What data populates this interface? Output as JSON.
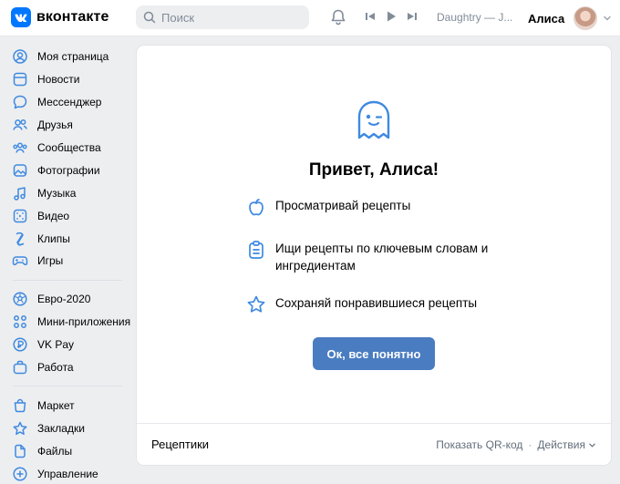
{
  "header": {
    "logo_text": "вконтакте",
    "search_placeholder": "Поиск",
    "now_playing": "Daughtry — J...",
    "user_name": "Алиса"
  },
  "sidebar": {
    "group1": [
      {
        "label": "Моя страница",
        "icon": "user-circle-icon"
      },
      {
        "label": "Новости",
        "icon": "news-icon"
      },
      {
        "label": "Мессенджер",
        "icon": "message-icon"
      },
      {
        "label": "Друзья",
        "icon": "friends-icon"
      },
      {
        "label": "Сообщества",
        "icon": "communities-icon"
      },
      {
        "label": "Фотографии",
        "icon": "photo-icon"
      },
      {
        "label": "Музыка",
        "icon": "music-icon"
      },
      {
        "label": "Видео",
        "icon": "video-icon"
      },
      {
        "label": "Клипы",
        "icon": "clips-icon"
      },
      {
        "label": "Игры",
        "icon": "gamepad-icon"
      }
    ],
    "group2": [
      {
        "label": "Евро-2020",
        "icon": "ball-icon"
      },
      {
        "label": "Мини-приложения",
        "icon": "apps-icon"
      },
      {
        "label": "VK Pay",
        "icon": "vkpay-icon"
      },
      {
        "label": "Работа",
        "icon": "briefcase-icon"
      }
    ],
    "group3": [
      {
        "label": "Маркет",
        "icon": "market-icon"
      },
      {
        "label": "Закладки",
        "icon": "star-icon"
      },
      {
        "label": "Файлы",
        "icon": "file-icon"
      },
      {
        "label": "Управление",
        "icon": "manage-icon"
      }
    ]
  },
  "main": {
    "greeting": "Привет, Алиса!",
    "features": [
      "Просматривай рецепты",
      "Ищи рецепты по ключевым словам и ингредиентам",
      "Сохраняй понравившиеся рецепты"
    ],
    "ok_button": "Ок, все понятно"
  },
  "footer": {
    "app_name": "Рецептики",
    "qr_link": "Показать QR-код",
    "actions": "Действия"
  },
  "colors": {
    "accent": "#4a7cc1",
    "brand": "#0077ff",
    "icon_blue": "#3f8ae0",
    "background": "#edeef0"
  }
}
